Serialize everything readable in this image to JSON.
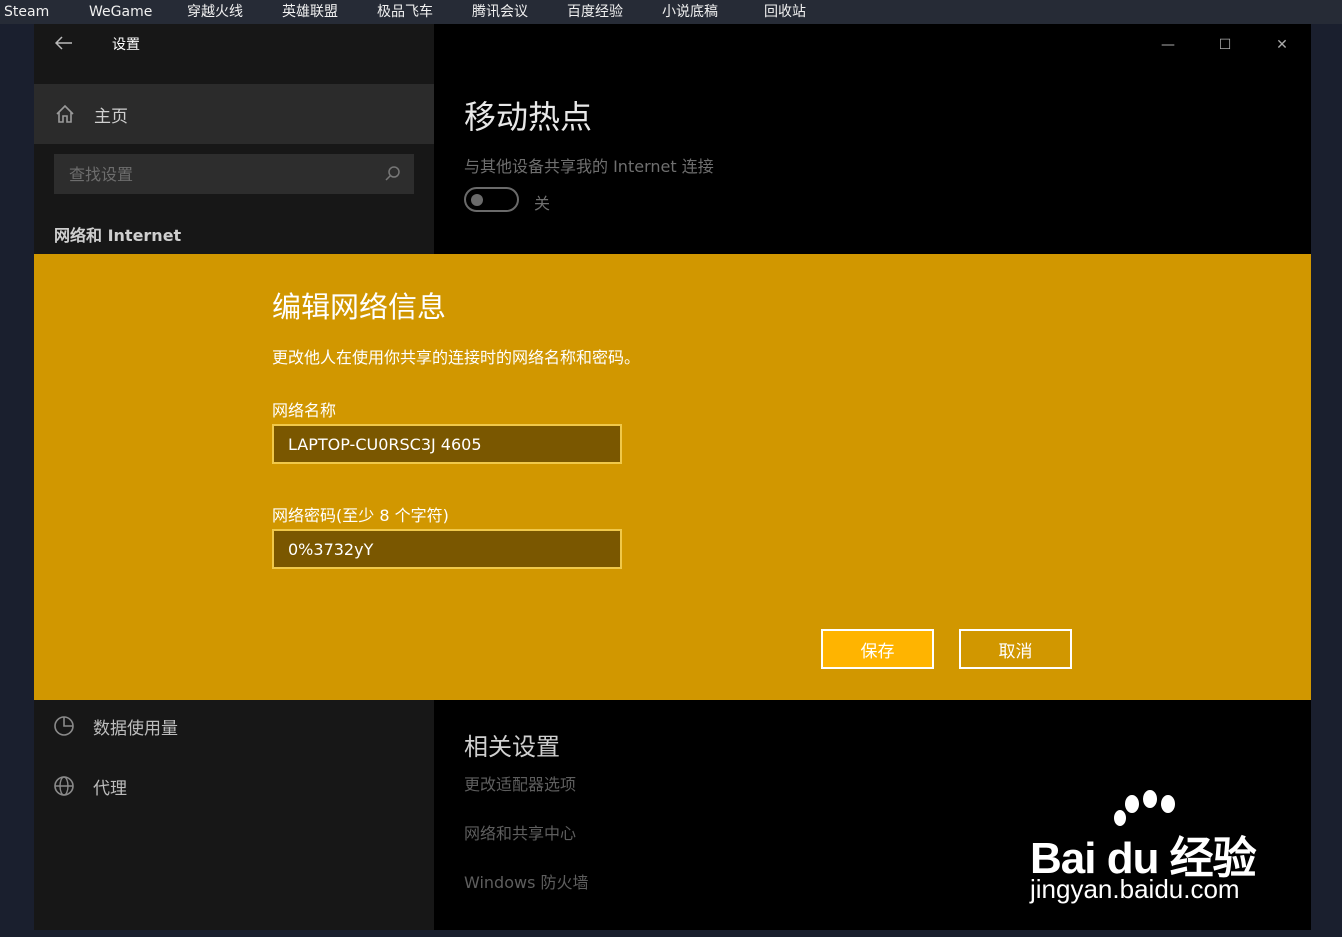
{
  "desktop_bar": {
    "items": [
      "Steam",
      "WeGame",
      "穿越火线",
      "英雄联盟",
      "极品飞车",
      "腾讯会议",
      "百度经验",
      "小说底稿",
      "回收站"
    ]
  },
  "window": {
    "title": "设置",
    "controls": {
      "minimize": "—",
      "maximize": "☐",
      "close": "✕"
    }
  },
  "sidebar": {
    "home_label": "主页",
    "search_placeholder": "查找设置",
    "section_title": "网络和 Internet",
    "items": [
      {
        "label": "数据使用量",
        "icon": "pie-chart-icon"
      },
      {
        "label": "代理",
        "icon": "globe-icon"
      }
    ]
  },
  "hotspot": {
    "title": "移动热点",
    "subtitle": "与其他设备共享我的 Internet 连接",
    "toggle_label": "关",
    "toggle_on": false
  },
  "related": {
    "title": "相关设置",
    "links": [
      "更改适配器选项",
      "网络和共享中心",
      "Windows 防火墙"
    ]
  },
  "dialog": {
    "title": "编辑网络信息",
    "description": "更改他人在使用你共享的连接时的网络名称和密码。",
    "name_label": "网络名称",
    "name_value": "LAPTOP-CU0RSC3J 4605",
    "password_label": "网络密码(至少 8 个字符)",
    "password_value": "0%3732yY",
    "save_label": "保存",
    "cancel_label": "取消",
    "accent_color": "#d19700"
  },
  "watermark": {
    "main": "Bai du 经验",
    "url": "jingyan.baidu.com"
  }
}
